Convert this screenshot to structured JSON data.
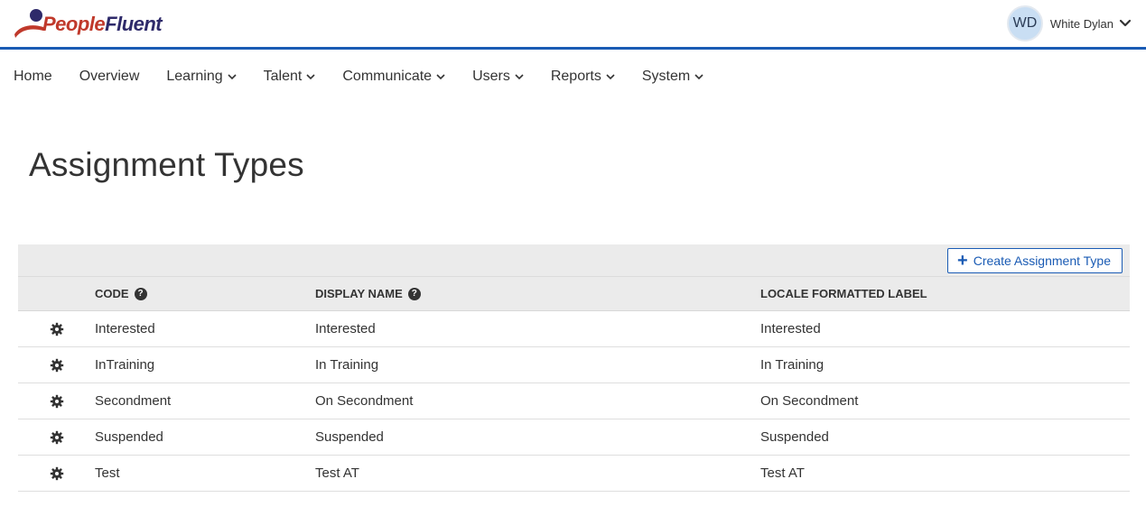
{
  "header": {
    "logo_text_people": "People",
    "logo_text_fluent": "Fluent",
    "user_initials": "WD",
    "user_name": "White Dylan"
  },
  "nav": {
    "items": [
      {
        "label": "Home",
        "has_dropdown": false
      },
      {
        "label": "Overview",
        "has_dropdown": false
      },
      {
        "label": "Learning",
        "has_dropdown": true
      },
      {
        "label": "Talent",
        "has_dropdown": true
      },
      {
        "label": "Communicate",
        "has_dropdown": true
      },
      {
        "label": "Users",
        "has_dropdown": true
      },
      {
        "label": "Reports",
        "has_dropdown": true
      },
      {
        "label": "System",
        "has_dropdown": true
      }
    ]
  },
  "page": {
    "title": "Assignment Types"
  },
  "toolbar": {
    "create_label": "Create Assignment Type"
  },
  "table": {
    "columns": [
      "CODE",
      "DISPLAY NAME",
      "LOCALE FORMATTED LABEL"
    ],
    "rows": [
      {
        "code": "Interested",
        "display_name": "Interested",
        "locale_label": "Interested"
      },
      {
        "code": "InTraining",
        "display_name": "In Training",
        "locale_label": "In Training"
      },
      {
        "code": "Secondment",
        "display_name": "On Secondment",
        "locale_label": "On Secondment"
      },
      {
        "code": "Suspended",
        "display_name": "Suspended",
        "locale_label": "Suspended"
      },
      {
        "code": "Test",
        "display_name": "Test AT",
        "locale_label": "Test AT"
      }
    ]
  },
  "colors": {
    "brand_blue": "#1a5bb4",
    "logo_red": "#c0392b",
    "logo_navy": "#2e2a6a",
    "header_gray": "#ebebeb"
  }
}
